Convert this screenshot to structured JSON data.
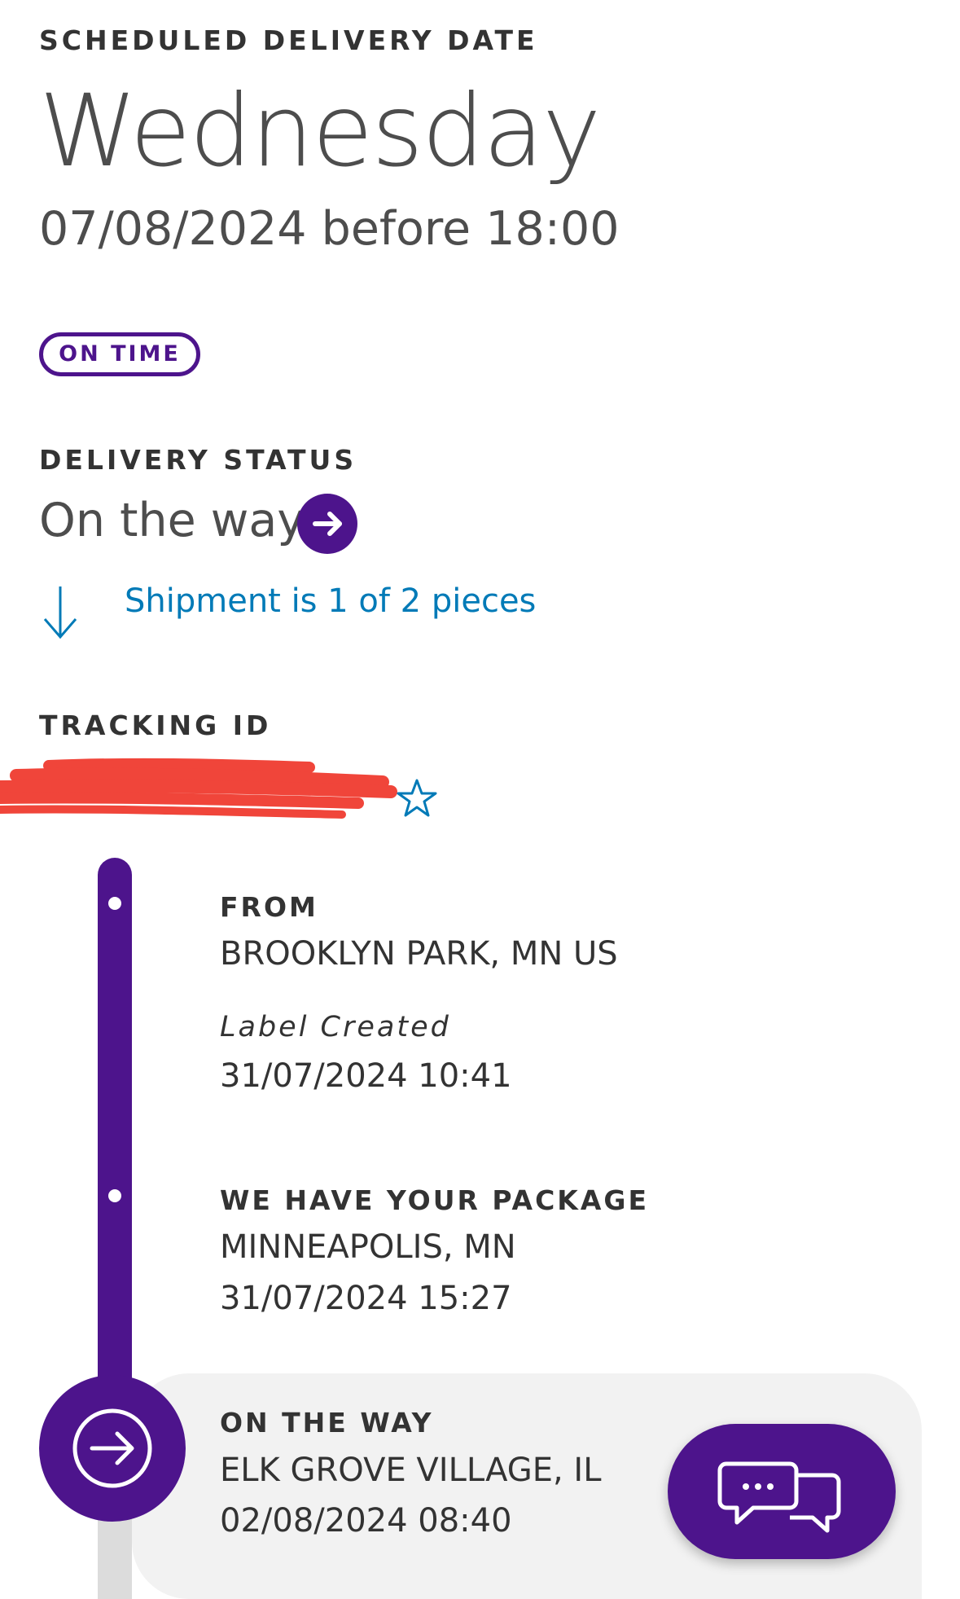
{
  "scheduled": {
    "label": "SCHEDULED DELIVERY DATE",
    "day": "Wednesday",
    "datetime": "07/08/2024 before 18:00",
    "badge": "ON TIME"
  },
  "delivery_status": {
    "label": "DELIVERY STATUS",
    "value": "On the way",
    "pieces_link": "Shipment is 1 of 2 pieces"
  },
  "tracking": {
    "label": "TRACKING ID"
  },
  "timeline": {
    "from": {
      "label": "FROM",
      "location": "BROOKLYN PARK, MN US",
      "event": "Label Created",
      "datetime": "31/07/2024 10:41"
    },
    "picked_up": {
      "label": "WE HAVE YOUR PACKAGE",
      "location": "MINNEAPOLIS, MN",
      "datetime": "31/07/2024 15:27"
    },
    "current": {
      "label": "ON THE WAY",
      "location": "ELK GROVE VILLAGE, IL",
      "datetime": "02/08/2024 08:40"
    }
  },
  "colors": {
    "brand_purple": "#4d148c",
    "link_blue": "#007ab7",
    "redaction_red": "#f0453a"
  },
  "icons": {
    "status_arrow": "arrow-right-circle-icon",
    "pieces_arrow": "arrow-down-icon",
    "favorite": "star-outline-icon",
    "current_step": "arrow-right-circle-icon",
    "chat": "chat-bubbles-icon"
  }
}
